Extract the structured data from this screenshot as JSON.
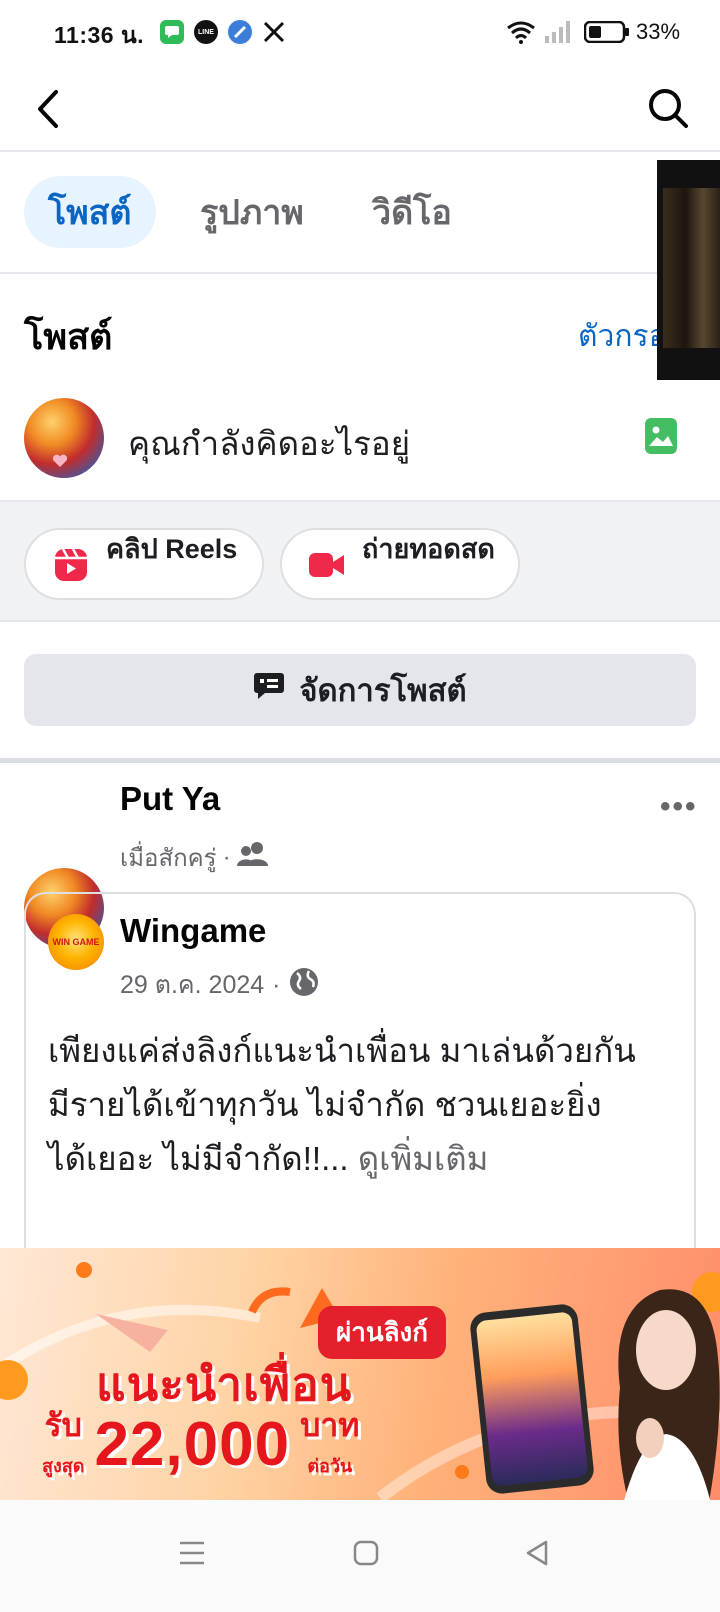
{
  "status_bar": {
    "time": "11:36 น.",
    "battery": "33%",
    "app_icons": [
      "messages-icon",
      "line-icon",
      "app-icon",
      "x-icon"
    ]
  },
  "top_nav": {
    "back_icon": "chevron-left-icon",
    "search_icon": "search-icon"
  },
  "tabs": [
    {
      "label": "โพสต์",
      "active": true
    },
    {
      "label": "รูปภาพ",
      "active": false
    },
    {
      "label": "วิดีโอ",
      "active": false
    }
  ],
  "posts_section": {
    "title": "โพสต์",
    "filter_label": "ตัวกรอง"
  },
  "composer": {
    "placeholder": "คุณกำลังคิดอะไรอยู่",
    "photo_icon": "photo-icon"
  },
  "quick_actions": [
    {
      "label": "คลิป Reels",
      "icon": "reels-icon"
    },
    {
      "label": "ถ่ายทอดสด",
      "icon": "live-video-icon"
    }
  ],
  "manage_posts": {
    "label": "จัดการโพสต์",
    "icon": "manage-posts-icon"
  },
  "post": {
    "author": "Put Ya",
    "time": "เมื่อสักครู่",
    "audience_icon": "friends-icon",
    "shared": {
      "page_name": "Wingame",
      "logo_text": "WIN GAME",
      "date": "29 ต.ค. 2024",
      "audience_icon": "globe-icon",
      "body": [
        "เพียงแค่ส่งลิงก์แนะนำเพื่อน มาเล่นด้วยกัน",
        "มีรายได้เข้าทุกวัน ไม่จำกัด ชวนเยอะยิ่ง",
        "ได้เยอะ ไม่มีจำกัด!!..."
      ],
      "see_more": "ดูเพิ่มเติม"
    }
  },
  "banner": {
    "tag": "ผ่านลิงก์",
    "headline": "แนะนำเพื่อน",
    "receive": "รับ",
    "up_to": "สูงสุด",
    "amount": "22,000",
    "unit": "บาท",
    "per_day": "ต่อวัน"
  },
  "colors": {
    "facebook_blue": "#0a66c2",
    "tab_active_bg": "#e7f3ff",
    "reels_red": "#f02849",
    "photo_green": "#45bd62"
  }
}
